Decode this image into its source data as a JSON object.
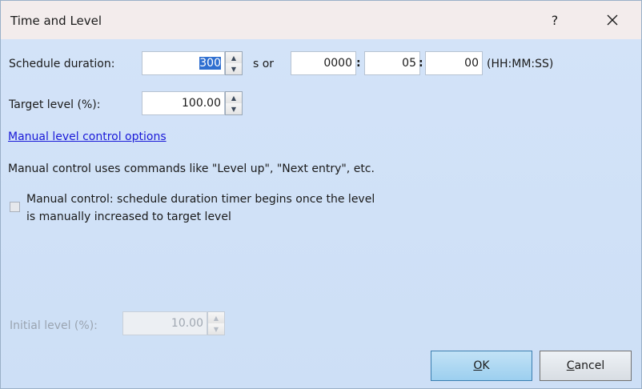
{
  "window": {
    "title": "Time and Level",
    "help_label": "?",
    "close_icon": "close-icon"
  },
  "schedule": {
    "label": "Schedule duration:",
    "seconds_value": "300",
    "unit_text": "s or",
    "hours": "0000",
    "minutes": "05",
    "seconds": "00",
    "colon": ":",
    "format_hint": "(HH:MM:SS)"
  },
  "target": {
    "label": "Target level (%):",
    "value": "100.00"
  },
  "manual": {
    "link_text": "Manual level control options",
    "description": "Manual control uses commands like \"Level up\", \"Next entry\", etc.",
    "checkbox_line1": "Manual control: schedule duration timer begins once the level",
    "checkbox_line2": "is manually increased to target level",
    "checkbox_checked": false
  },
  "initial": {
    "label": "Initial level (%):",
    "value": "10.00",
    "enabled": false
  },
  "buttons": {
    "ok_mnemonic": "O",
    "ok_rest": "K",
    "cancel_mnemonic": "C",
    "cancel_rest": "ancel"
  },
  "colors": {
    "client_background": "#d3e3f8",
    "titlebar_background": "#f3ecec",
    "link": "#1a1ad8",
    "selection": "#2f6fd0",
    "default_button": "#9ccfef"
  }
}
